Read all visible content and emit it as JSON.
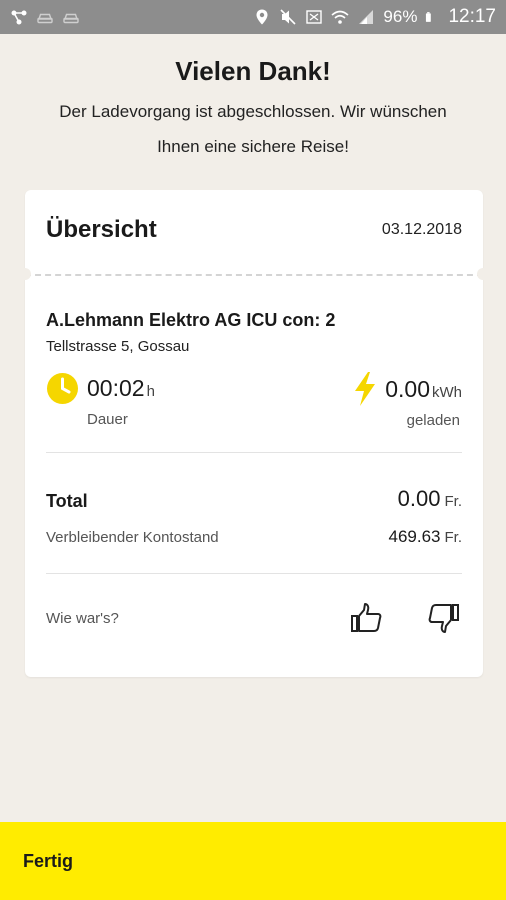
{
  "status_bar": {
    "battery": "96%",
    "time": "12:17",
    "left_icons": [
      "network-icon",
      "car-icon",
      "car-icon"
    ],
    "right_icons": [
      "location-icon",
      "mute-icon",
      "data-icon",
      "wifi-icon",
      "signal-icon",
      "battery-icon"
    ]
  },
  "header": {
    "title": "Vielen Dank!",
    "subtitle_line1": "Der Ladevorgang ist abgeschlossen. Wir wünschen",
    "subtitle_line2": "Ihnen eine sichere Reise!"
  },
  "summary": {
    "title": "Übersicht",
    "date": "03.12.2018",
    "station_name": "A.Lehmann Elektro AG ICU con: 2",
    "station_address": "Tellstrasse 5, Gossau",
    "duration": {
      "value": "00:02",
      "unit": "h",
      "label": "Dauer",
      "icon": "clock-icon"
    },
    "energy": {
      "value": "0.00",
      "unit": "kWh",
      "label": "geladen",
      "icon": "lightning-icon"
    },
    "total": {
      "label": "Total",
      "value": "0.00",
      "currency": "Fr."
    },
    "balance": {
      "label": "Verbleibender Kontostand",
      "value": "469.63",
      "currency": "Fr."
    },
    "feedback": {
      "label": "Wie war's?",
      "up_icon": "thumbs-up-icon",
      "down_icon": "thumbs-down-icon"
    }
  },
  "actions": {
    "done_label": "Fertig"
  },
  "colors": {
    "accent": "#ffec00",
    "icon_yellow": "#f5d600",
    "background": "#f2eee8",
    "statusbar": "#8d8d8d"
  }
}
